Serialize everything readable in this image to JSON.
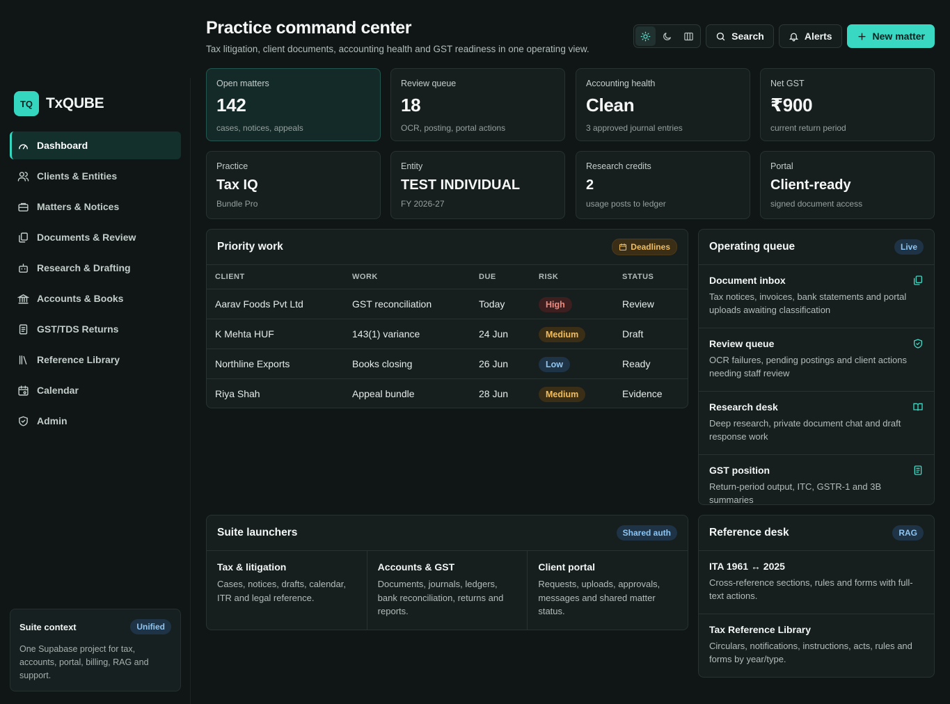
{
  "brand": {
    "mark": "TQ",
    "name": "TxQUBE"
  },
  "sidebar": {
    "items": [
      {
        "label": "Dashboard",
        "icon": "gauge-icon",
        "active": true
      },
      {
        "label": "Clients & Entities",
        "icon": "users-icon"
      },
      {
        "label": "Matters & Notices",
        "icon": "briefcase-icon"
      },
      {
        "label": "Documents & Review",
        "icon": "documents-icon"
      },
      {
        "label": "Research & Drafting",
        "icon": "bot-icon"
      },
      {
        "label": "Accounts & Books",
        "icon": "bank-icon"
      },
      {
        "label": "GST/TDS Returns",
        "icon": "receipt-icon"
      },
      {
        "label": "Reference Library",
        "icon": "library-icon"
      },
      {
        "label": "Calendar",
        "icon": "calendar-icon"
      },
      {
        "label": "Admin",
        "icon": "shield-icon"
      }
    ]
  },
  "suite_context": {
    "title": "Suite context",
    "badge": "Unified",
    "text": "One Supabase project for tax, accounts, portal, billing, RAG and support."
  },
  "header": {
    "title": "Practice command center",
    "subtitle": "Tax litigation, client documents, accounting health and GST readiness in one operating view."
  },
  "toolbar": {
    "search": "Search",
    "alerts": "Alerts",
    "new_matter": "New matter"
  },
  "stats": [
    {
      "label": "Open matters",
      "value": "142",
      "sub": "cases, notices, appeals"
    },
    {
      "label": "Review queue",
      "value": "18",
      "sub": "OCR, posting, portal actions"
    },
    {
      "label": "Accounting health",
      "value": "Clean",
      "sub": "3 approved journal entries"
    },
    {
      "label": "Net GST",
      "value": "₹900",
      "sub": "current return period"
    },
    {
      "label": "Practice",
      "value": "Tax IQ",
      "sub": "Bundle Pro"
    },
    {
      "label": "Entity",
      "value": "TEST INDIVIDUAL",
      "sub": "FY 2026-27"
    },
    {
      "label": "Research credits",
      "value": "2",
      "sub": "usage posts to ledger"
    },
    {
      "label": "Portal",
      "value": "Client-ready",
      "sub": "signed document access"
    }
  ],
  "priority": {
    "title": "Priority work",
    "badge": "Deadlines",
    "columns": [
      "CLIENT",
      "WORK",
      "DUE",
      "RISK",
      "STATUS"
    ],
    "rows": [
      {
        "client": "Aarav Foods Pvt Ltd",
        "work": "GST reconciliation",
        "due": "Today",
        "risk": "High",
        "risk_level": "high",
        "status": "Review"
      },
      {
        "client": "K Mehta HUF",
        "work": "143(1) variance",
        "due": "24 Jun",
        "risk": "Medium",
        "risk_level": "medium",
        "status": "Draft"
      },
      {
        "client": "Northline Exports",
        "work": "Books closing",
        "due": "26 Jun",
        "risk": "Low",
        "risk_level": "low",
        "status": "Ready"
      },
      {
        "client": "Riya Shah",
        "work": "Appeal bundle",
        "due": "28 Jun",
        "risk": "Medium",
        "risk_level": "medium",
        "status": "Evidence"
      }
    ]
  },
  "operating_queue": {
    "title": "Operating queue",
    "badge": "Live",
    "items": [
      {
        "title": "Document inbox",
        "text": "Tax notices, invoices, bank statements and portal uploads awaiting classification",
        "icon": "documents-icon"
      },
      {
        "title": "Review queue",
        "text": "OCR failures, pending postings and client actions needing staff review",
        "icon": "shield-check-icon"
      },
      {
        "title": "Research desk",
        "text": "Deep research, private document chat and draft response work",
        "icon": "book-open-icon"
      },
      {
        "title": "GST position",
        "text": "Return-period output, ITC, GSTR-1 and 3B summaries",
        "icon": "receipt-icon"
      }
    ]
  },
  "launchers": {
    "title": "Suite launchers",
    "badge": "Shared auth",
    "items": [
      {
        "title": "Tax & litigation",
        "text": "Cases, notices, drafts, calendar, ITR and legal reference."
      },
      {
        "title": "Accounts & GST",
        "text": "Documents, journals, ledgers, bank reconciliation, returns and reports."
      },
      {
        "title": "Client portal",
        "text": "Requests, uploads, approvals, messages and shared matter status."
      }
    ]
  },
  "reference_desk": {
    "title": "Reference desk",
    "badge": "RAG",
    "items": [
      {
        "title": "ITA 1961 ↔ 2025",
        "text": "Cross-reference sections, rules and forms with full-text actions."
      },
      {
        "title": "Tax Reference Library",
        "text": "Circulars, notifications, instructions, acts, rules and forms by year/type."
      }
    ]
  }
}
